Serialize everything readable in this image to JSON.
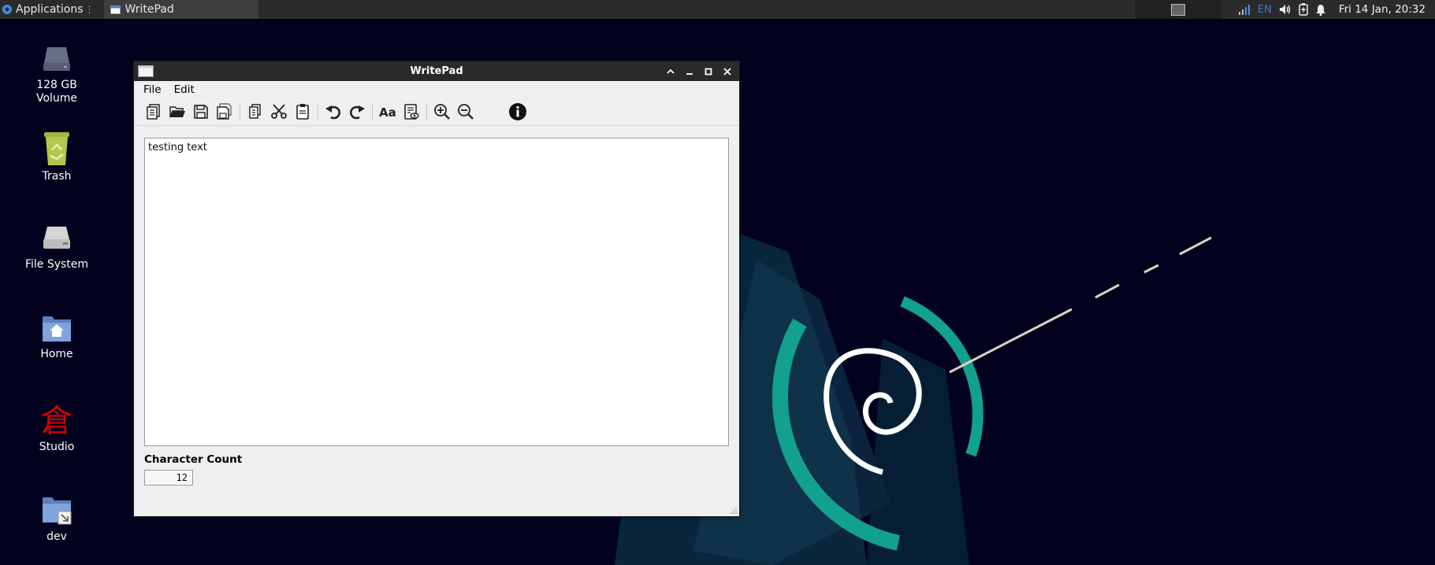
{
  "panel": {
    "apps_label": "Applications",
    "task_label": "WritePad",
    "lang": "EN",
    "clock": "Fri 14 Jan, 20:32"
  },
  "desktop": {
    "icons": [
      {
        "label_line1": "128 GB",
        "label_line2": "Volume",
        "icon": "drive-icon"
      },
      {
        "label": "Trash",
        "icon": "trash-icon"
      },
      {
        "label": "File System",
        "icon": "filesystem-icon"
      },
      {
        "label": "Home",
        "icon": "home-folder-icon"
      },
      {
        "label": "Studio",
        "icon": "studio-icon"
      },
      {
        "label": "dev",
        "icon": "folder-link-icon"
      }
    ]
  },
  "window": {
    "title": "WritePad",
    "menu": [
      "File",
      "Edit"
    ],
    "editor_text": "testing text",
    "char_count_label": "Character Count",
    "char_count_value": "12"
  },
  "colors": {
    "wallpaper_bg": "#02021f",
    "accent_teal": "#12a08f",
    "panel_bg": "#2b2b2b"
  }
}
